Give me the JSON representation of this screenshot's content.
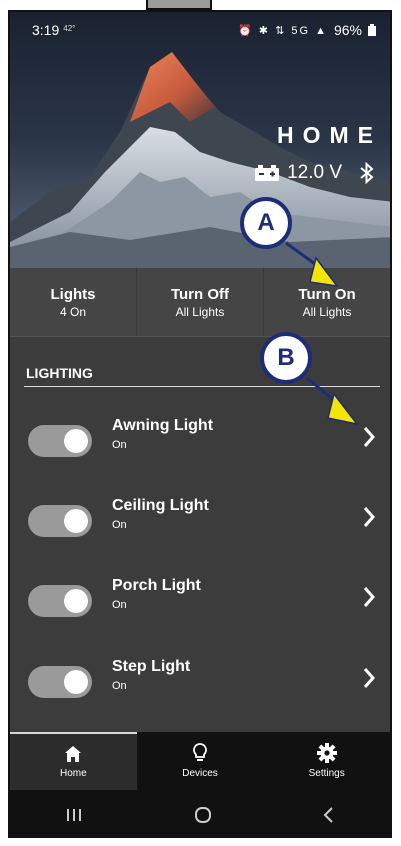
{
  "status_bar": {
    "time": "3:19",
    "temperature": "42°",
    "icons": "⏰ ✱ ⇅ 5G ▲",
    "battery_percent": "96%"
  },
  "header": {
    "title": "HOME",
    "voltage": "12.0 V"
  },
  "quick_actions": [
    {
      "title": "Lights",
      "subtitle": "4 On"
    },
    {
      "title": "Turn Off",
      "subtitle": "All Lights"
    },
    {
      "title": "Turn On",
      "subtitle": "All Lights"
    }
  ],
  "lighting": {
    "section_title": "LIGHTING",
    "items": [
      {
        "name": "Awning Light",
        "state": "On",
        "toggle_on": true
      },
      {
        "name": "Ceiling Light",
        "state": "On",
        "toggle_on": true
      },
      {
        "name": "Porch Light",
        "state": "On",
        "toggle_on": true
      },
      {
        "name": "Step Light",
        "state": "On",
        "toggle_on": true
      }
    ]
  },
  "bottom_nav": [
    {
      "label": "Home",
      "icon": "home-icon",
      "active": true
    },
    {
      "label": "Devices",
      "icon": "bulb-icon",
      "active": false
    },
    {
      "label": "Settings",
      "icon": "gear-icon",
      "active": false
    }
  ],
  "annotations": [
    {
      "label": "A"
    },
    {
      "label": "B"
    }
  ],
  "colors": {
    "callout_border": "#1e2c7a",
    "arrow_fill": "#f3e600",
    "toggle_track": "#9a9a9a",
    "list_background": "#3c3c3c"
  }
}
